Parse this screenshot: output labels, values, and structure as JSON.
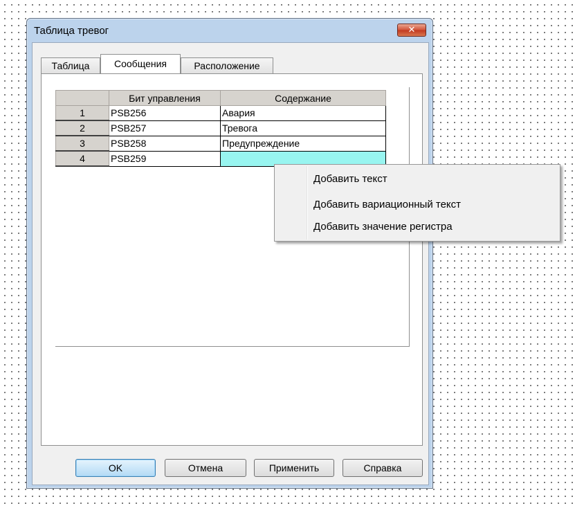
{
  "window": {
    "title": "Таблица тревог",
    "close_glyph": "✕"
  },
  "tabs": [
    {
      "label": "Таблица",
      "active": false
    },
    {
      "label": "Сообщения",
      "active": true
    },
    {
      "label": "Расположение",
      "active": false
    }
  ],
  "table": {
    "headers": [
      "",
      "Бит управления",
      "Содержание"
    ],
    "rows": [
      {
        "num": "1",
        "bit": "PSB256",
        "content": "Авария"
      },
      {
        "num": "2",
        "bit": "PSB257",
        "content": "Тревога"
      },
      {
        "num": "3",
        "bit": "PSB258",
        "content": "Предупреждение"
      },
      {
        "num": "4",
        "bit": "PSB259",
        "content": ""
      }
    ],
    "selected_cell_color": "#98f5f0"
  },
  "context_menu": {
    "items": [
      "Добавить текст",
      "Добавить вариационный текст",
      "Добавить значение регистра"
    ]
  },
  "buttons": {
    "ok": "OK",
    "cancel": "Отмена",
    "apply": "Применить",
    "help": "Справка"
  },
  "colors": {
    "title_bar": "#bcd3ec",
    "close_button": "#c9452b",
    "accent_default_button": "#3c7fb1"
  }
}
